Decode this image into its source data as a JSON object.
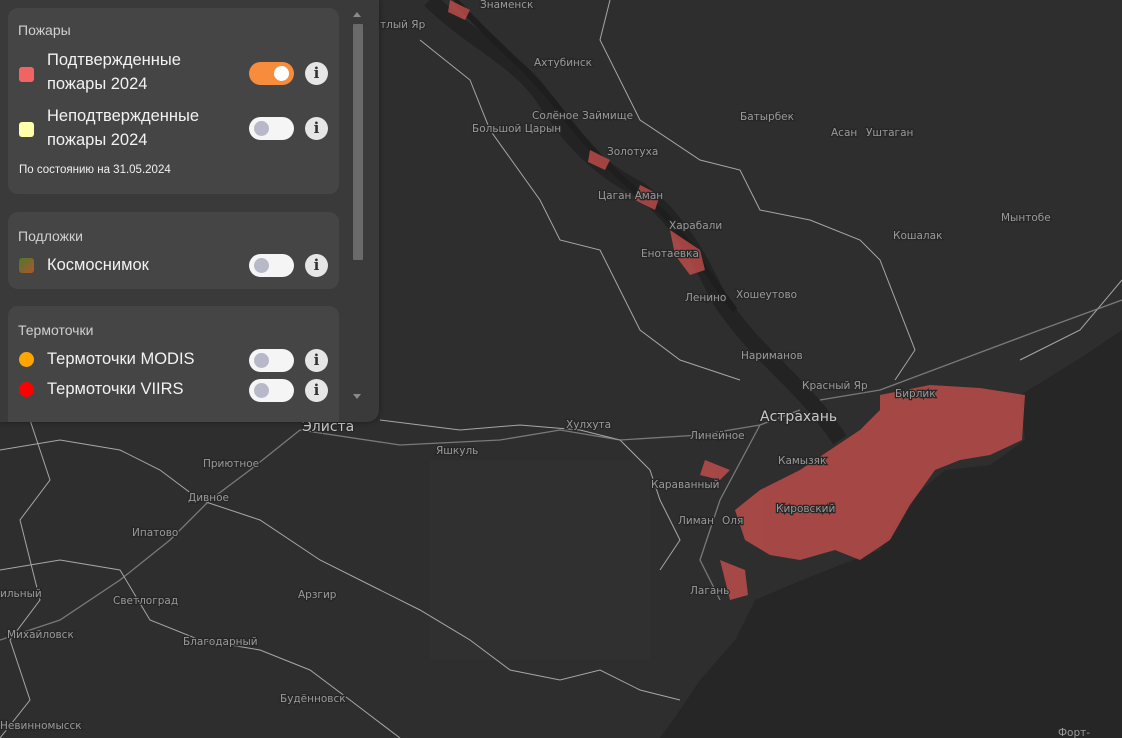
{
  "map": {
    "places": [
      {
        "id": "znamensk",
        "name": "Знаменск"
      },
      {
        "id": "krasny-yar-top",
        "name": "тлый Яр"
      },
      {
        "id": "akhtubinsk",
        "name": "Ахтубинск"
      },
      {
        "id": "bolshoy-tsaryn",
        "name": "Большой Царын"
      },
      {
        "id": "solenoe-zaimishche",
        "name": "Солёное Займище"
      },
      {
        "id": "zolotukha",
        "name": "Золотуха"
      },
      {
        "id": "tsagan-aman",
        "name": "Цаган Аман"
      },
      {
        "id": "kharabali",
        "name": "Харабали"
      },
      {
        "id": "enotaevka",
        "name": "Енотаевка"
      },
      {
        "id": "lenino",
        "name": "Ленино"
      },
      {
        "id": "khosheutovo",
        "name": "Хошеутово"
      },
      {
        "id": "narimanov",
        "name": "Нариманов"
      },
      {
        "id": "krasny-yar",
        "name": "Красный Яр"
      },
      {
        "id": "birlik",
        "name": "Бирлик"
      },
      {
        "id": "astrakhan",
        "name": "Астрахань"
      },
      {
        "id": "khulkhuta",
        "name": "Хулхута"
      },
      {
        "id": "elista",
        "name": "Элиста"
      },
      {
        "id": "yashkul",
        "name": "Яшкуль"
      },
      {
        "id": "lineynoe",
        "name": "Линейное"
      },
      {
        "id": "kamyzyak",
        "name": "Камызяк"
      },
      {
        "id": "karavanny",
        "name": "Караванный"
      },
      {
        "id": "kirovsky",
        "name": "Кировский"
      },
      {
        "id": "liman",
        "name": "Лиман"
      },
      {
        "id": "olya",
        "name": "Оля"
      },
      {
        "id": "lagan",
        "name": "Лагань"
      },
      {
        "id": "batyrbek",
        "name": "Батырбек"
      },
      {
        "id": "asan",
        "name": "Асан"
      },
      {
        "id": "ushtagan",
        "name": "Уштаган"
      },
      {
        "id": "myntobe",
        "name": "Мынтобе"
      },
      {
        "id": "koshalak",
        "name": "Кошалак"
      },
      {
        "id": "priyutnoe",
        "name": "Приютное"
      },
      {
        "id": "divnoe",
        "name": "Дивное"
      },
      {
        "id": "ipatovo",
        "name": "Ипатово"
      },
      {
        "id": "svetlograd",
        "name": "Светлоград"
      },
      {
        "id": "arzgir",
        "name": "Арзгир"
      },
      {
        "id": "mikhaylovsk",
        "name": "Михайловск"
      },
      {
        "id": "blagodarny",
        "name": "Благодарный"
      },
      {
        "id": "budennovsk",
        "name": "Будённовск"
      },
      {
        "id": "nevinnomyssk",
        "name": "Невинномысск"
      },
      {
        "id": "kilny",
        "name": "ильный"
      },
      {
        "id": "fort",
        "name": "Форт-"
      }
    ]
  },
  "panel": {
    "fires": {
      "title": "Пожары",
      "layers": [
        {
          "label": "Подтвержденные пожары 2024",
          "swatch_color": "#f26464",
          "enabled": true
        },
        {
          "label": "Неподтвержденные пожары 2024",
          "swatch_color": "#ffffaa",
          "enabled": false
        }
      ],
      "status": "По состоянию на 31.05.2024"
    },
    "basemaps": {
      "title": "Подложки",
      "layers": [
        {
          "label": "Космоснимок",
          "swatch_color": "#6b8a3a",
          "enabled": false
        }
      ]
    },
    "hotspots": {
      "title": "Термоточки",
      "layers": [
        {
          "label": "Термоточки MODIS",
          "swatch_color": "#ffa500",
          "enabled": false
        },
        {
          "label": "Термоточки VIIRS",
          "swatch_color": "#ff0000",
          "enabled": false
        }
      ]
    },
    "info_glyph": "i"
  },
  "colors": {
    "toggle_on": "#f78c3c",
    "fire_overlay": "#d9534f"
  }
}
